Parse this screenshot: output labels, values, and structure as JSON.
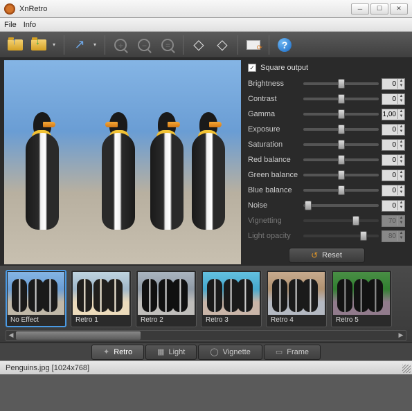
{
  "window": {
    "title": "XnRetro"
  },
  "menu": {
    "file": "File",
    "info": "Info"
  },
  "toolbar": {
    "open": "open",
    "save": "save",
    "share": "share",
    "zoom_in": "+",
    "zoom_out": "−",
    "zoom_fit": "=",
    "rotate_left": "rotate-left",
    "rotate_right": "rotate-right",
    "settings": "settings",
    "help": "?"
  },
  "controls": {
    "square_output": "Square output",
    "sliders": [
      {
        "label": "Brightness",
        "value": "0",
        "pos": 50,
        "enabled": true
      },
      {
        "label": "Contrast",
        "value": "0",
        "pos": 50,
        "enabled": true
      },
      {
        "label": "Gamma",
        "value": "1,00",
        "pos": 50,
        "enabled": true
      },
      {
        "label": "Exposure",
        "value": "0",
        "pos": 50,
        "enabled": true
      },
      {
        "label": "Saturation",
        "value": "0",
        "pos": 50,
        "enabled": true
      },
      {
        "label": "Red balance",
        "value": "0",
        "pos": 50,
        "enabled": true
      },
      {
        "label": "Green balance",
        "value": "0",
        "pos": 50,
        "enabled": true
      },
      {
        "label": "Blue balance",
        "value": "0",
        "pos": 50,
        "enabled": true
      },
      {
        "label": "Noise",
        "value": "0",
        "pos": 6,
        "enabled": true
      },
      {
        "label": "Vignetting",
        "value": "70",
        "pos": 70,
        "enabled": false
      },
      {
        "label": "Light opacity",
        "value": "80",
        "pos": 80,
        "enabled": false
      }
    ],
    "reset": "Reset"
  },
  "effects": [
    {
      "label": "No Effect",
      "cls": "",
      "selected": true
    },
    {
      "label": "Retro 1",
      "cls": "r1",
      "selected": false
    },
    {
      "label": "Retro 2",
      "cls": "r2",
      "selected": false
    },
    {
      "label": "Retro 3",
      "cls": "r3",
      "selected": false
    },
    {
      "label": "Retro 4",
      "cls": "r4",
      "selected": false
    },
    {
      "label": "Retro 5",
      "cls": "r5",
      "selected": false
    }
  ],
  "tabs": [
    {
      "label": "Retro",
      "icon": "✦",
      "active": true
    },
    {
      "label": "Light",
      "icon": "▦",
      "active": false
    },
    {
      "label": "Vignette",
      "icon": "◯",
      "active": false
    },
    {
      "label": "Frame",
      "icon": "▭",
      "active": false
    }
  ],
  "status": {
    "text": "Penguins.jpg [1024x768]"
  }
}
